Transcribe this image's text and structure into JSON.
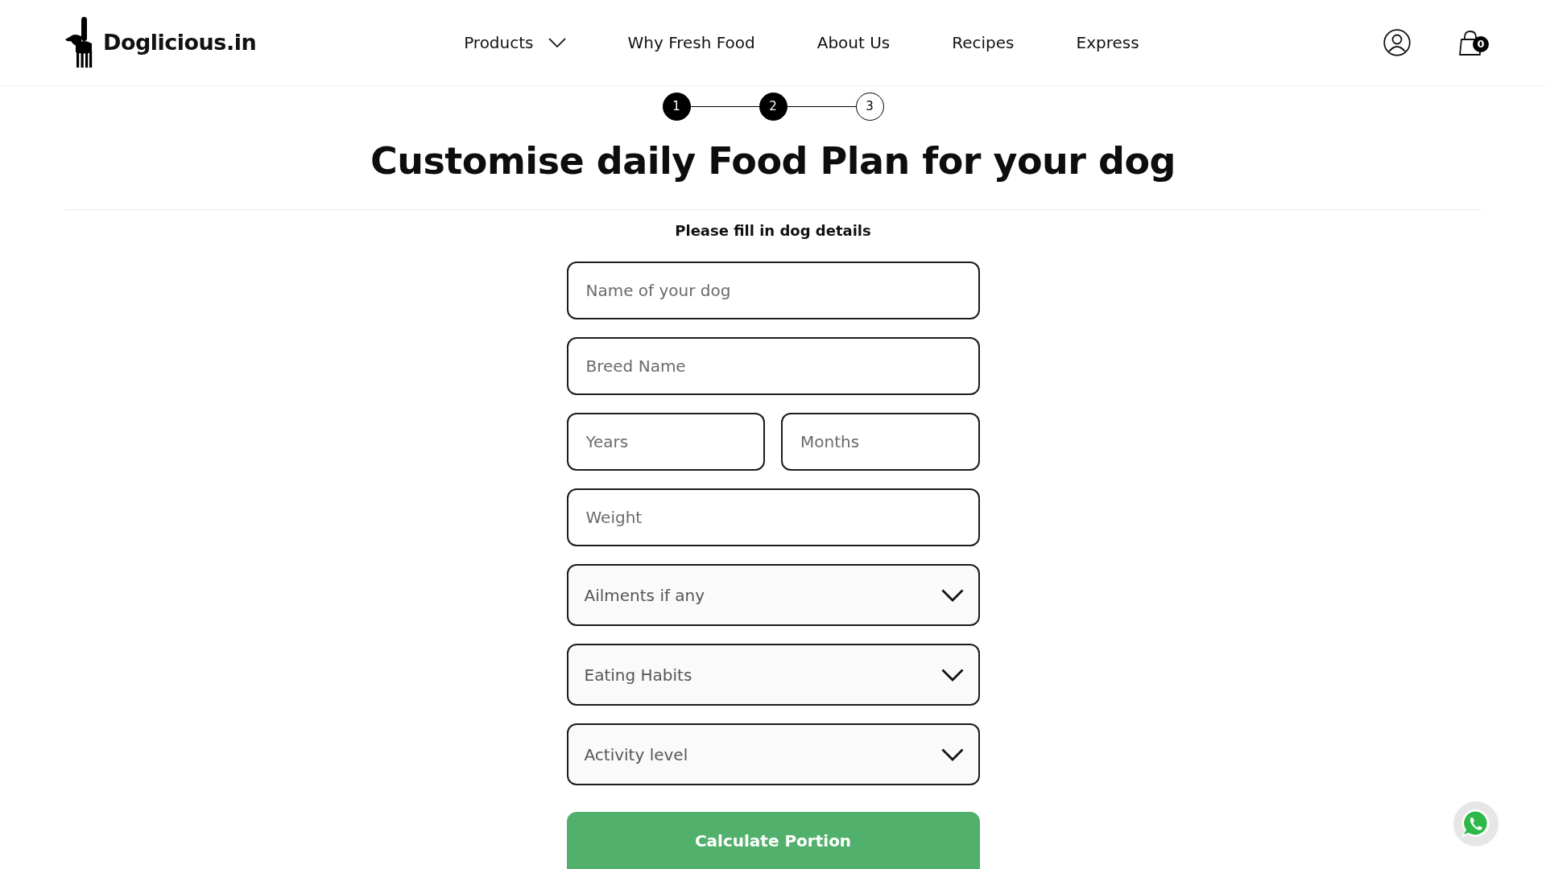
{
  "header": {
    "logo_text": "Doglicious.in",
    "nav": [
      {
        "label": "Products",
        "kind": "dropdown"
      },
      {
        "label": "Why Fresh Food",
        "kind": "link"
      },
      {
        "label": "About Us",
        "kind": "link"
      },
      {
        "label": "Recipes",
        "kind": "link"
      },
      {
        "label": "Express",
        "kind": "link"
      }
    ],
    "cart_count": "0"
  },
  "stepper": [
    {
      "label": "1",
      "completed": true
    },
    {
      "label": "2",
      "completed": true
    },
    {
      "label": "3",
      "completed": false
    }
  ],
  "title": "Customise daily Food Plan for your dog",
  "form": {
    "heading": "Please fill in dog details",
    "rows": [
      {
        "kind": "input",
        "fields": [
          {
            "placeholder": "Name of your dog"
          }
        ]
      },
      {
        "kind": "input",
        "fields": [
          {
            "placeholder": "Breed Name"
          }
        ]
      },
      {
        "kind": "input",
        "fields": [
          {
            "placeholder": "Years"
          },
          {
            "placeholder": "Months"
          }
        ]
      },
      {
        "kind": "input",
        "fields": [
          {
            "placeholder": "Weight"
          }
        ]
      },
      {
        "kind": "dropdown",
        "fields": [
          {
            "placeholder": "Ailments if any"
          }
        ]
      },
      {
        "kind": "dropdown",
        "fields": [
          {
            "placeholder": "Eating Habits"
          }
        ]
      },
      {
        "kind": "dropdown",
        "fields": [
          {
            "placeholder": "Activity level"
          }
        ]
      }
    ],
    "submit": "Calculate Portion"
  }
}
